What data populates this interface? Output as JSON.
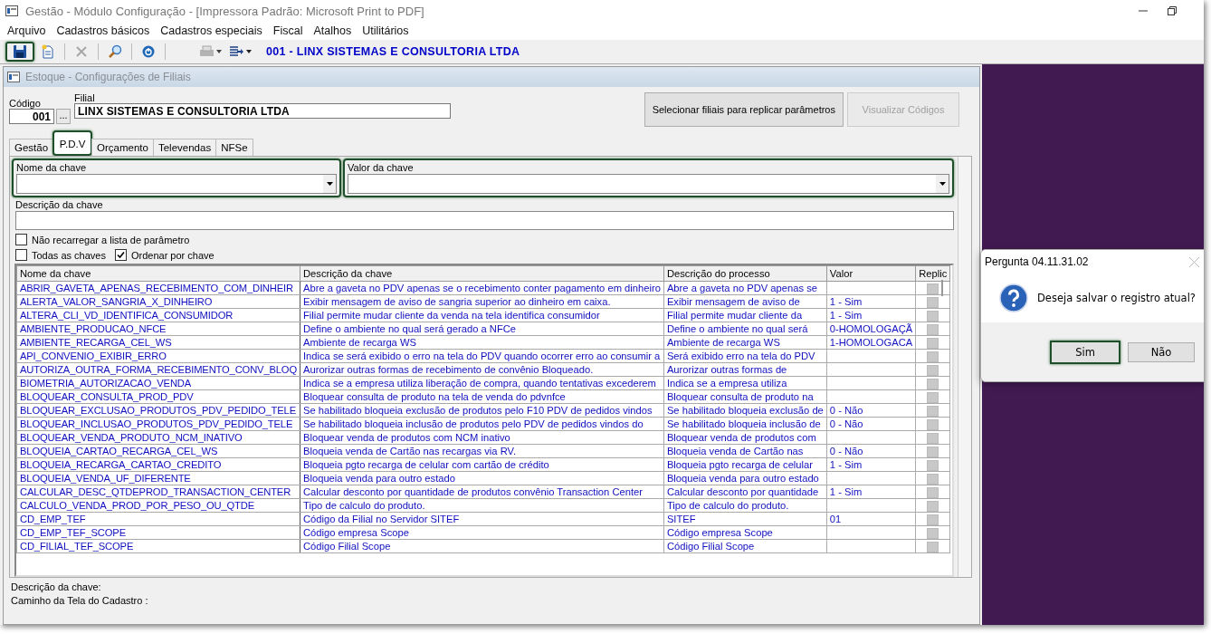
{
  "window": {
    "title": "Gestão  - Módulo Configuração - [Impressora Padrão: Microsoft Print to PDF]"
  },
  "menu": [
    "Arquivo",
    "Cadastros básicos",
    "Cadastros especiais",
    "Fiscal",
    "Atalhos",
    "Utilitários"
  ],
  "toolbar": {
    "tools": [
      {
        "kind": "save",
        "highlighted": true,
        "disabled": false
      },
      {
        "kind": "new",
        "highlighted": false,
        "disabled": false
      },
      {
        "kind": "delete",
        "highlighted": false,
        "disabled": true
      },
      {
        "kind": "search",
        "highlighted": false,
        "disabled": false
      },
      {
        "kind": "power",
        "highlighted": false,
        "disabled": false
      },
      {
        "kind": "print",
        "highlighted": false,
        "disabled": true
      },
      {
        "kind": "export",
        "highlighted": false,
        "disabled": false
      }
    ],
    "company": "001 - LINX SISTEMAS E CONSULTORIA LTDA"
  },
  "child_window": {
    "title": "Estoque - Configurações de Filiais"
  },
  "codigo": {
    "label": "Código",
    "value": "001",
    "lookup": "..."
  },
  "filial": {
    "label": "Filial",
    "value": "LINX SISTEMAS E CONSULTORIA LTDA"
  },
  "buttons": [
    {
      "label": "Selecionar filiais para replicar parâmetros",
      "disabled": false
    },
    {
      "label": "Visualizar Códigos",
      "disabled": true
    }
  ],
  "tabs": [
    {
      "label": "Gestão",
      "selected": false,
      "highlighted": false
    },
    {
      "label": "P.D.V",
      "selected": true,
      "highlighted": true
    },
    {
      "label": "Orçamento",
      "selected": false,
      "highlighted": false
    },
    {
      "label": "Televendas",
      "selected": false,
      "highlighted": false
    },
    {
      "label": "NFSe",
      "selected": false,
      "highlighted": false
    }
  ],
  "key_fields": [
    {
      "label": "Nome da chave",
      "highlighted": true
    },
    {
      "label": "Valor da chave",
      "highlighted": true
    }
  ],
  "descricao": {
    "label": "Descrição da chave"
  },
  "checkboxes": [
    {
      "label": "Não recarregar a lista de parâmetro",
      "checked": false
    },
    {
      "label": "Todas as chaves",
      "checked": false
    },
    {
      "label": "Ordenar por chave",
      "checked": true
    }
  ],
  "table": {
    "columns": [
      "Nome da chave",
      "Descrição  da chave",
      "Descrição do processo",
      "Valor",
      "Replic"
    ],
    "rows": [
      {
        "name": "ABRIR_GAVETA_APENAS_RECEBIMENTO_COM_DINHEIR",
        "description": "Abre a gaveta no PDV apenas se o recebimento conter pagamento em dinheiro",
        "process": "Abre a gaveta no PDV apenas se",
        "replicate": false
      },
      {
        "name": "ALERTA_VALOR_SANGRIA_X_DINHEIRO",
        "description": "Exibir mensagem de aviso de sangria superior ao dinheiro em caixa.",
        "process": "Exibir mensagem de aviso de",
        "value": "1 - Sim",
        "replicate": false
      },
      {
        "name": "ALTERA_CLI_VD_IDENTIFICA_CONSUMIDOR",
        "description": "Filial permite mudar cliente da venda na tela identifica consumidor",
        "process": "Filial permite mudar cliente da",
        "value": "1 - Sim",
        "replicate": false
      },
      {
        "name": "AMBIENTE_PRODUCAO_NFCE",
        "description": "Define o ambiente no qual será gerado a NFCe",
        "process": "Define o ambiente no qual será",
        "value": "0-HOMOLOGAÇÃ",
        "replicate": false
      },
      {
        "name": "AMBIENTE_RECARGA_CEL_WS",
        "description": "Ambiente de recarga WS",
        "process": "Ambiente de recarga WS",
        "value": "1-HOMOLOGACA",
        "replicate": false
      },
      {
        "name": "API_CONVENIO_EXIBIR_ERRO",
        "description": "Indica se será exibido o erro na tela do PDV quando ocorrer  erro ao consumir a",
        "process": "Será exibido erro na tela do PDV",
        "replicate": false
      },
      {
        "name": "AUTORIZA_OUTRA_FORMA_RECEBIMENTO_CONV_BLOQ",
        "description": "Aurorizar outras formas de recebimento de convênio Bloqueado.",
        "process": "Aurorizar outras formas de",
        "replicate": false
      },
      {
        "name": "BIOMETRIA_AUTORIZACAO_VENDA",
        "description": "Indica se a empresa utiliza liberação de compra, quando tentativas excederem",
        "process": "Indica se a empresa utiliza",
        "replicate": false
      },
      {
        "name": "BLOQUEAR_CONSULTA_PROD_PDV",
        "description": "Bloquear consulta de produto na tela de venda do pdvnfce",
        "process": "Bloquear consulta de produto na",
        "replicate": false
      },
      {
        "name": "BLOQUEAR_EXCLUSAO_PRODUTOS_PDV_PEDIDO_TELE",
        "description": "Se habilitado bloqueia exclusão de produtos pelo F10 PDV de pedidos vindos",
        "process": "Se habilitado bloqueia exclusão de",
        "value": "0 - Não",
        "replicate": false
      },
      {
        "name": "BLOQUEAR_INCLUSAO_PRODUTOS_PDV_PEDIDO_TELE",
        "description": "Se habilitado bloqueia inclusão de produtos pelo PDV de pedidos vindos do",
        "process": "Se habilitado bloqueia inclusão de",
        "value": "0 - Não",
        "replicate": false
      },
      {
        "name": "BLOQUEAR_VENDA_PRODUTO_NCM_INATIVO",
        "description": "Bloquear venda de produtos com NCM inativo",
        "process": "Bloquear venda de produtos com",
        "replicate": false
      },
      {
        "name": "BLOQUEIA_CARTAO_RECARGA_CEL_WS",
        "description": "Bloqueia venda de Cartão nas recargas via RV.",
        "process": "Bloqueia venda de Cartão nas",
        "value": "0 - Não",
        "replicate": false
      },
      {
        "name": "BLOQUEIA_RECARGA_CARTAO_CREDITO",
        "description": "Bloqueia pgto recarga de celular com cartão de crédito",
        "process": "Bloqueia pgto recarga de celular",
        "value": "1 - Sim",
        "replicate": false
      },
      {
        "name": "BLOQUEIA_VENDA_UF_DIFERENTE",
        "description": "Bloqueia venda para outro estado",
        "process": "Bloqueia venda para outro estado",
        "replicate": false
      },
      {
        "name": "CALCULAR_DESC_QTDEPROD_TRANSACTION_CENTER",
        "description": "Calcular desconto por quantidade de produtos convênio Transaction Center",
        "process": "Calcular desconto por quantidade",
        "value": "1 - Sim",
        "replicate": false
      },
      {
        "name": "CALCULO_VENDA_PROD_POR_PESO_OU_QTDE",
        "description": "Tipo de calculo do produto.",
        "process": "Tipo de calculo do produto.",
        "replicate": false
      },
      {
        "name": "CD_EMP_TEF",
        "description": "Código da Filial no Servidor SITEF",
        "process": "SITEF",
        "value": "01",
        "replicate": false
      },
      {
        "name": "CD_EMP_TEF_SCOPE",
        "description": "Código empresa Scope",
        "process": "Código empresa Scope",
        "replicate": false
      },
      {
        "name": "CD_FILIAL_TEF_SCOPE",
        "description": "Código Filial Scope",
        "process": "Código Filial Scope",
        "replicate": false
      }
    ]
  },
  "footer": [
    "Descrição da chave:",
    "Caminho da Tela do Cadastro :"
  ],
  "dialog": {
    "title": "Pergunta 04.11.31.02",
    "message": "Deseja salvar o registro atual?",
    "buttons": [
      {
        "label": "Sim",
        "highlighted": true
      },
      {
        "label": "Não",
        "highlighted": false
      }
    ]
  }
}
